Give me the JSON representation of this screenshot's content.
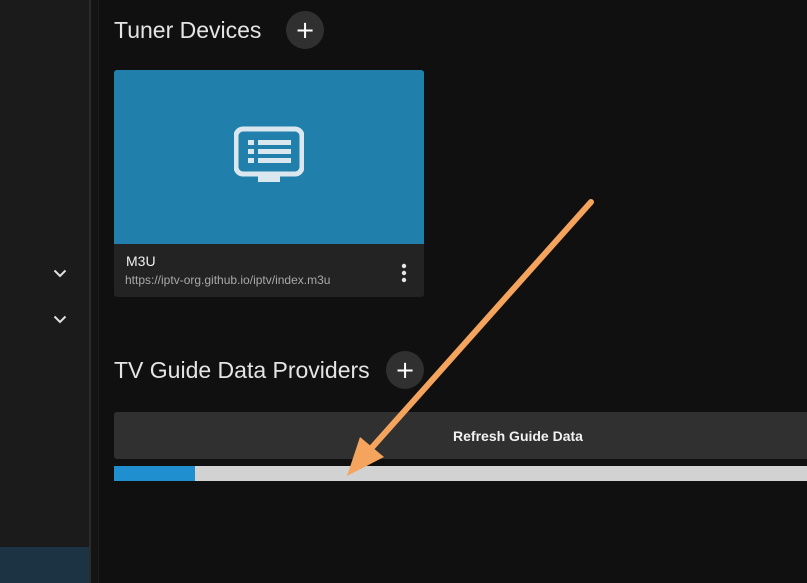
{
  "sections": {
    "tuner_devices": {
      "title": "Tuner Devices",
      "add_label": "+"
    },
    "guide_providers": {
      "title": "TV Guide Data Providers",
      "add_label": "+"
    }
  },
  "tuner_card": {
    "name": "M3U",
    "url": "https://iptv-org.github.io/iptv/index.m3u",
    "icon": "tv-guide-icon"
  },
  "guide": {
    "refresh_label": "Refresh Guide Data",
    "progress_fraction": 0.117
  },
  "colors": {
    "card_accent": "#2080ab",
    "progress_fill": "#1f8fd0",
    "annotation_arrow": "#f5a45d"
  }
}
